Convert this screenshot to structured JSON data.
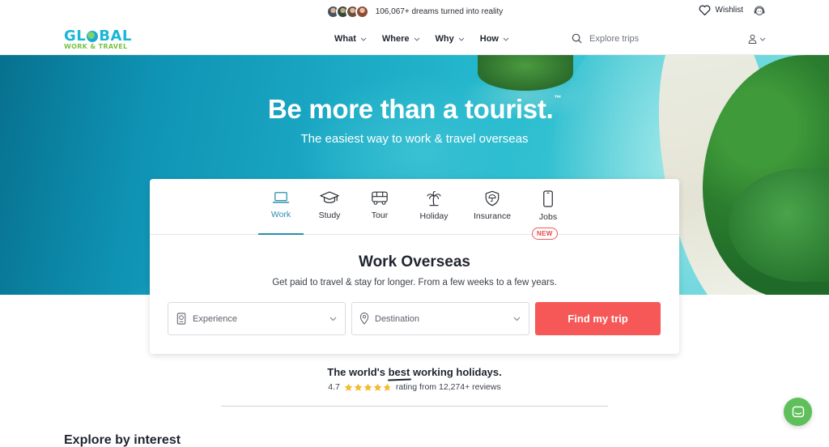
{
  "topbar": {
    "social_proof": "106,067+ dreams turned into reality",
    "wishlist_label": "Wishlist"
  },
  "logo": {
    "line1_a": "GL",
    "line1_b": "BAL",
    "line2": "WORK & TRAVEL"
  },
  "nav": {
    "items": [
      {
        "label": "What"
      },
      {
        "label": "Where"
      },
      {
        "label": "Why"
      },
      {
        "label": "How"
      }
    ],
    "search_placeholder": "Explore trips"
  },
  "hero": {
    "title": "Be more than a tourist.",
    "title_mark": "™",
    "subtitle": "The easiest way to work & travel overseas"
  },
  "card": {
    "tabs": [
      {
        "label": "Work",
        "icon": "laptop-icon",
        "active": true
      },
      {
        "label": "Study",
        "icon": "graduation-cap-icon"
      },
      {
        "label": "Tour",
        "icon": "bus-icon"
      },
      {
        "label": "Holiday",
        "icon": "palm-tree-icon"
      },
      {
        "label": "Insurance",
        "icon": "shield-umbrella-icon"
      },
      {
        "label": "Jobs",
        "icon": "phone-icon"
      }
    ],
    "jobs_badge": "NEW",
    "title": "Work Overseas",
    "subtitle": "Get paid to travel & stay for longer. From a few weeks to a few years.",
    "experience_label": "Experience",
    "destination_label": "Destination",
    "cta_label": "Find my trip"
  },
  "reviews": {
    "tagline_pre": "The world's",
    "tagline_emph": "best",
    "tagline_post": "working holidays.",
    "score": "4.7",
    "stars": 4.7,
    "rating_text": "rating from 12,274+ reviews"
  },
  "section": {
    "title": "Explore by interest"
  },
  "colors": {
    "accent_blue": "#2a8fb3",
    "cta_red": "#f65858",
    "star_gold": "#f5b92a",
    "chat_green": "#5fbf5a"
  }
}
